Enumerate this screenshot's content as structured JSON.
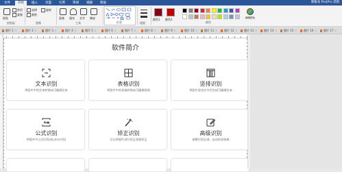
{
  "titlebar": {
    "tabs": [
      "文件",
      "开始",
      "插入",
      "页面",
      "引用",
      "审阅",
      "视图",
      "帮助"
    ],
    "active_tab": "开始",
    "user": "新账号 Pro|Pro 识别"
  },
  "ribbon": {
    "clipboard": {
      "paste": "粘贴",
      "cut": "剪切",
      "copy": "复制",
      "label": "剪贴板"
    },
    "tools": {
      "select": "选择",
      "crop": "裁剪",
      "rotate": "旋转",
      "label": "图像"
    },
    "brush": {
      "pencil": "画笔",
      "fill": "填充",
      "text": "文字",
      "erase": "橡皮",
      "label": "工具"
    },
    "shapes": {
      "label": "形状"
    },
    "size": {
      "label": "粗细"
    },
    "colors": {
      "color1": "颜色1",
      "color2": "颜色2",
      "edit": "编辑颜色",
      "label": "颜色"
    },
    "swatches": [
      "#000000",
      "#7f7f7f",
      "#880015",
      "#ed1c24",
      "#ff7f27",
      "#fff200",
      "#22b14c",
      "#00a2e8",
      "#3f48cc",
      "#a349a4",
      "#ffffff",
      "#c3c3c3",
      "#b97a57",
      "#ffaec9",
      "#ffc90e",
      "#efe4b0",
      "#b5e61d",
      "#99d9ea",
      "#7092be",
      "#c8bfe7"
    ],
    "primary_color": "#880015",
    "secondary_color": "#c00000"
  },
  "file_tabs": [
    "图片 1",
    "图片 2",
    "图片 3",
    "图片 4",
    "图片 5",
    "图片 6",
    "图片 7",
    "图片 8",
    "图片 9",
    "图片 10",
    "图片 11",
    "图片 12",
    "图片 13",
    "图片 14",
    "图片 15",
    "图片 16",
    "图片 17"
  ],
  "page": {
    "title": "软件简介",
    "cards": [
      {
        "icon": "text-scan-icon",
        "title": "文本识别",
        "desc": "将图片中的文本转换成可编辑文本"
      },
      {
        "icon": "table-icon",
        "title": "表格识别",
        "desc": "将图片中的表格转换成可编辑表格"
      },
      {
        "icon": "vertical-text-icon",
        "title": "竖排识别",
        "desc": "将图片竖排文字识别成可编辑文本"
      },
      {
        "icon": "formula-icon",
        "title": "公式识别",
        "desc": "将图片中公式识别成Latex代码"
      },
      {
        "icon": "magic-wand-icon",
        "title": "矫正识别",
        "desc": "可以将图片进行矫正透视矫正"
      },
      {
        "icon": "edit-icon",
        "title": "高级识别",
        "desc": "调整识别区域，自动检测表格"
      }
    ]
  }
}
